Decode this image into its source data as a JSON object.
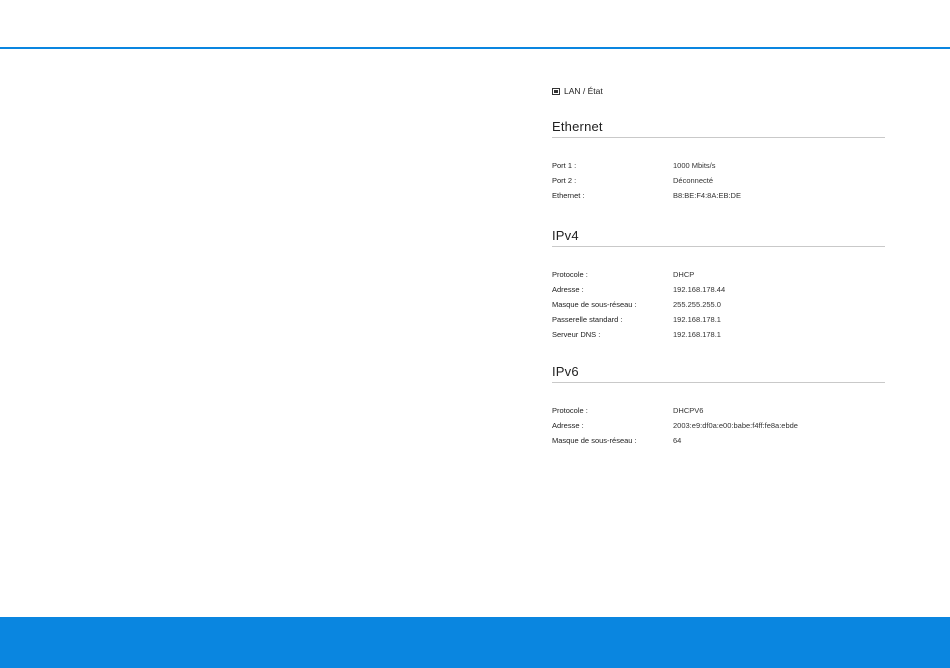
{
  "breadcrumb": {
    "icon": "lan-port-icon",
    "text": "LAN / État"
  },
  "ethernet": {
    "title": "Ethernet",
    "rows": [
      {
        "label": "Port 1 :",
        "value": "1000 Mbits/s"
      },
      {
        "label": "Port 2 :",
        "value": "Déconnecté"
      },
      {
        "label": "Ethernet :",
        "value": "B8:BE:F4:8A:EB:DE"
      }
    ]
  },
  "ipv4": {
    "title": "IPv4",
    "rows": [
      {
        "label": "Protocole :",
        "value": "DHCP"
      },
      {
        "label": "Adresse :",
        "value": "192.168.178.44"
      },
      {
        "label": "Masque de sous-réseau :",
        "value": "255.255.255.0"
      },
      {
        "label": "Passerelle standard :",
        "value": "192.168.178.1"
      },
      {
        "label": "Serveur DNS :",
        "value": "192.168.178.1"
      }
    ]
  },
  "ipv6": {
    "title": "IPv6",
    "rows": [
      {
        "label": "Protocole :",
        "value": "DHCPV6"
      },
      {
        "label": "Adresse :",
        "value": "2003:e9:df0a:e00:babe:f4ff:fe8a:ebde"
      },
      {
        "label": "Masque de sous-réseau :",
        "value": "64"
      }
    ]
  },
  "colors": {
    "accent": "#0a86e0",
    "divider": "#c9c9c9"
  }
}
